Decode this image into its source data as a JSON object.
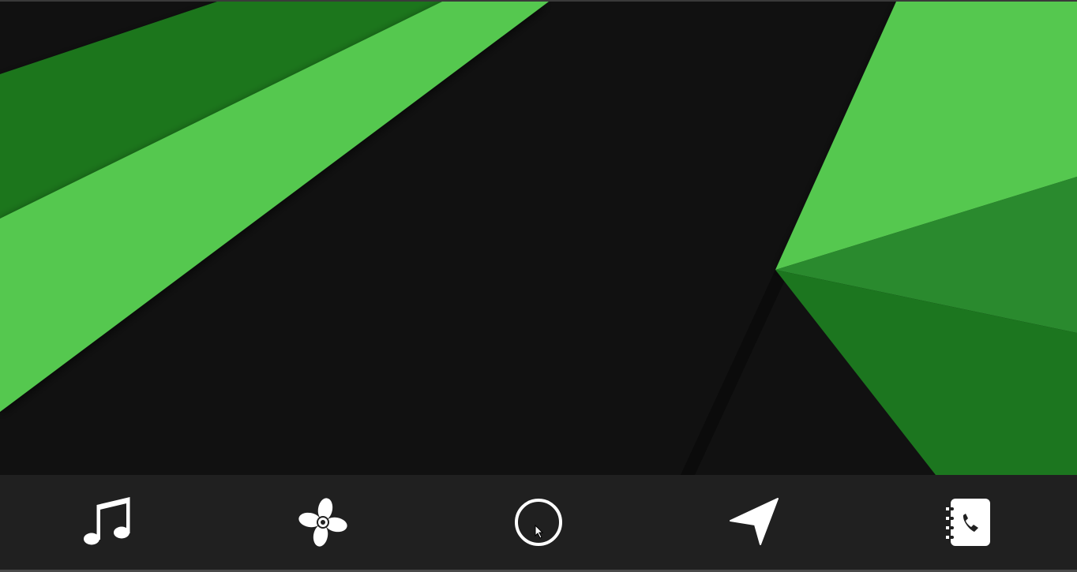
{
  "theme": {
    "background": "#111111",
    "dock_background": "#202020",
    "green_light": "#55c850",
    "green_mid": "#2a8a2e",
    "green_dark": "#1c761f",
    "icon_color": "#ffffff"
  },
  "dock": {
    "items": [
      {
        "icon": "music-note-icon"
      },
      {
        "icon": "fan-icon"
      },
      {
        "icon": "home-circle-icon"
      },
      {
        "icon": "navigation-arrow-icon"
      },
      {
        "icon": "phone-book-icon"
      }
    ]
  }
}
